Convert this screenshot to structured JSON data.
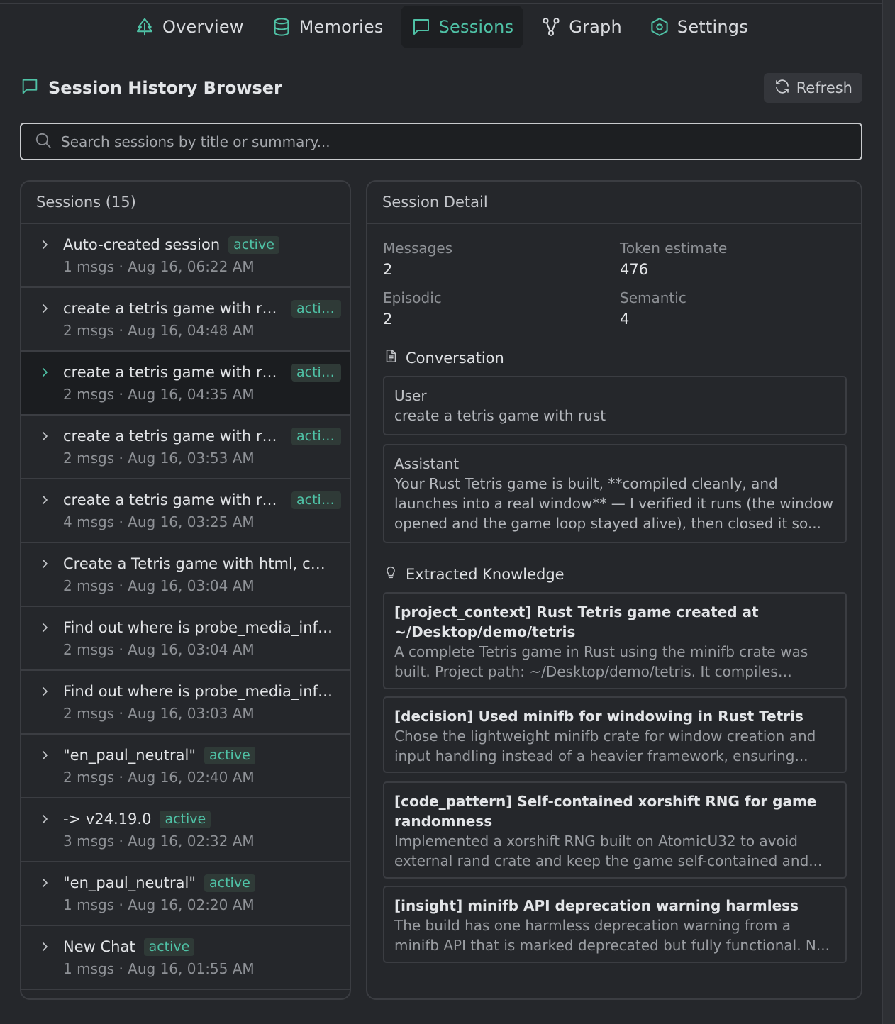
{
  "nav": {
    "tabs": [
      {
        "label": "Overview",
        "icon": "tree-icon",
        "active": false
      },
      {
        "label": "Memories",
        "icon": "database-icon",
        "active": false
      },
      {
        "label": "Sessions",
        "icon": "chat-icon",
        "active": true
      },
      {
        "label": "Graph",
        "icon": "graph-icon",
        "active": false
      },
      {
        "label": "Settings",
        "icon": "settings-icon",
        "active": false
      }
    ]
  },
  "header": {
    "title": "Session History Browser",
    "refresh_label": "Refresh"
  },
  "search": {
    "placeholder": "Search sessions by title or summary..."
  },
  "sessions": {
    "heading": "Sessions (15)",
    "items": [
      {
        "title": "Auto-created session",
        "badge": "active",
        "meta": "1 msgs · Aug 16, 06:22 AM"
      },
      {
        "title": "create a tetris game with rust",
        "badge": "active",
        "meta": "2 msgs · Aug 16, 04:48 AM"
      },
      {
        "title": "create a tetris game with rust",
        "badge": "active",
        "meta": "2 msgs · Aug 16, 04:35 AM"
      },
      {
        "title": "create a tetris game with rust",
        "badge": "active",
        "meta": "2 msgs · Aug 16, 03:53 AM"
      },
      {
        "title": "create a tetris game with rust",
        "badge": "active",
        "meta": "4 msgs · Aug 16, 03:25 AM"
      },
      {
        "title": "Create a Tetris game with html, css and javascript",
        "badge": "",
        "meta": "2 msgs · Aug 16, 03:04 AM"
      },
      {
        "title": "Find out where is probe_media_info defined",
        "badge": "",
        "meta": "2 msgs · Aug 16, 03:04 AM"
      },
      {
        "title": "Find out where is probe_media_info defined",
        "badge": "",
        "meta": "2 msgs · Aug 16, 03:03 AM"
      },
      {
        "title": "\"en_paul_neutral\"",
        "badge": "active",
        "meta": "2 msgs · Aug 16, 02:40 AM"
      },
      {
        "title": "-> v24.19.0",
        "badge": "active",
        "meta": "3 msgs · Aug 16, 02:32 AM"
      },
      {
        "title": "\"en_paul_neutral\"",
        "badge": "active",
        "meta": "1 msgs · Aug 16, 02:20 AM"
      },
      {
        "title": "New Chat",
        "badge": "active",
        "meta": "1 msgs · Aug 16, 01:55 AM"
      }
    ]
  },
  "detail": {
    "heading": "Session Detail",
    "stats": {
      "messages_label": "Messages",
      "messages": "2",
      "tokens_label": "Token estimate",
      "tokens": "476",
      "episodic_label": "Episodic",
      "episodic": "2",
      "semantic_label": "Semantic",
      "semantic": "4"
    },
    "conversation_heading": "Conversation",
    "messages": [
      {
        "role": "User",
        "text": "create a tetris game with rust"
      },
      {
        "role": "Assistant",
        "text": "Your Rust Tetris game is built, **compiled cleanly, and launches into a real window** — I verified it runs (the window opened and the game loop stayed alive), then closed it so..."
      }
    ],
    "knowledge_heading": "Extracted Knowledge",
    "knowledge": [
      {
        "title": "[project_context] Rust Tetris game created at ~/Desktop/demo/tetris",
        "body": "A complete Tetris game in Rust using the minifb crate was built. Project path: ~/Desktop/demo/tetris. It compiles cleanly..."
      },
      {
        "title": "[decision] Used minifb for windowing in Rust Tetris",
        "body": "Chose the lightweight minifb crate for window creation and input handling instead of a heavier framework, ensuring..."
      },
      {
        "title": "[code_pattern] Self-contained xorshift RNG for game randomness",
        "body": "Implemented a xorshift RNG built on AtomicU32 to avoid external rand crate and keep the game self-contained and..."
      },
      {
        "title": "[insight] minifb API deprecation warning harmless",
        "body": "The build has one harmless deprecation warning from a minifb API that is marked deprecated but fully functional. N..."
      }
    ]
  },
  "colors": {
    "accent": "#4fc2a6",
    "background": "#25272b",
    "border": "#3b3d42"
  }
}
